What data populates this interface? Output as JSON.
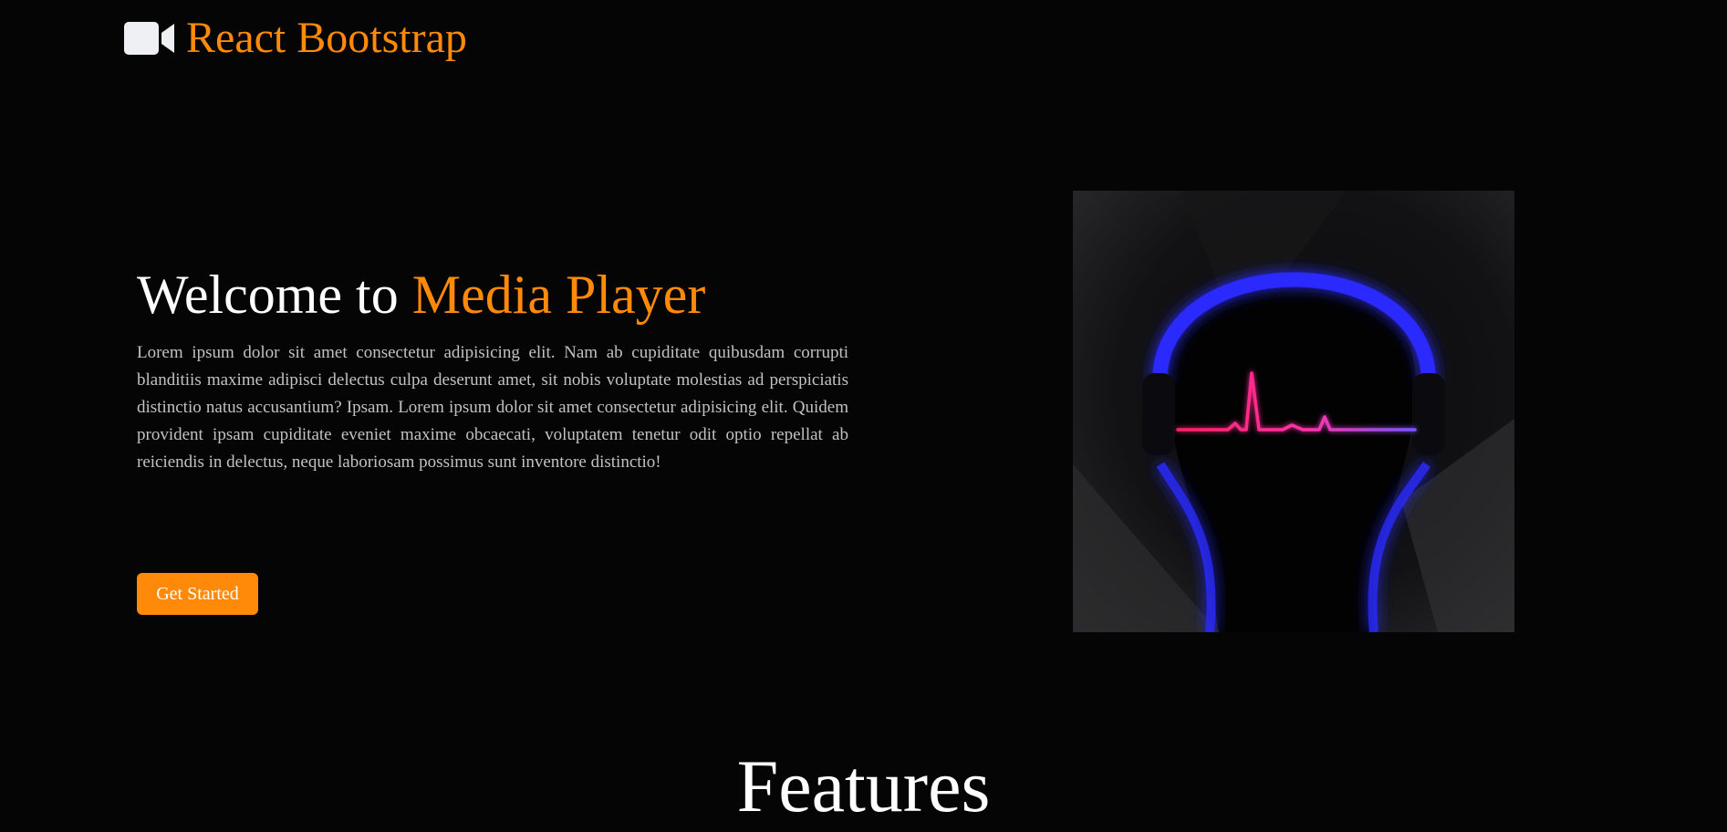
{
  "navbar": {
    "brand_icon": "video-camera-icon",
    "brand_text": "React Bootstrap"
  },
  "hero": {
    "title_prefix": "Welcome to ",
    "title_highlight": "Media Player",
    "description": "Lorem ipsum dolor sit amet consectetur adipisicing elit. Nam ab cupiditate quibusdam corrupti blanditiis maxime adipisci delectus culpa deserunt amet, sit nobis voluptate molestias ad perspiciatis distinctio natus accusantium? Ipsam. Lorem ipsum dolor sit amet consectetur adipisicing elit. Quidem provident ipsam cupiditate eveniet maxime obcaecati, voluptatem tenetur odit optio repellat ab reiciendis in delectus, neque laboriosam possimus sunt inventore distinctio!",
    "cta_label": "Get Started",
    "image_icon": "headphones-heartbeat-illustration"
  },
  "features": {
    "heading": "Features"
  },
  "colors": {
    "background": "#050505",
    "accent": "#ff8a0a",
    "text": "#ffffff",
    "muted_text": "#c2c2c2",
    "headphone_glow": "#2a2aff",
    "heartbeat_start": "#ff2266",
    "heartbeat_end": "#7a55ff"
  }
}
